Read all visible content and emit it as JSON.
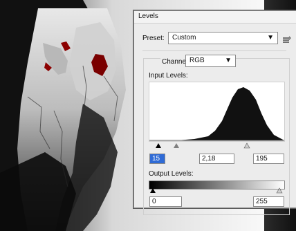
{
  "window": {
    "title": "Levels"
  },
  "preset": {
    "label": "Preset:",
    "value": "Custom"
  },
  "channel": {
    "label": "Channel:",
    "value": "RGB"
  },
  "input_levels": {
    "label": "Input Levels:",
    "black": "15",
    "gamma": "2,18",
    "white": "195"
  },
  "output_levels": {
    "label": "Output Levels:",
    "black": "0",
    "white": "255"
  },
  "icons": {
    "preset_dropdown": "chevron-down-icon",
    "channel_dropdown": "chevron-down-icon",
    "preset_menu": "panel-menu-icon"
  }
}
